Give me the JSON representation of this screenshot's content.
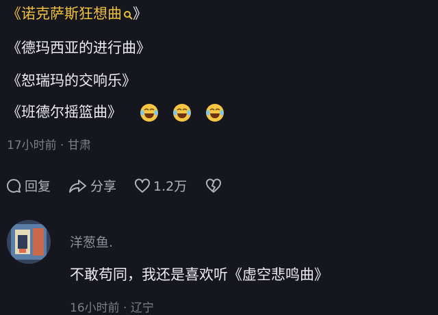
{
  "comment": {
    "lines": [
      "《诺克萨斯狂想曲",
      "》",
      "《德玛西亚的进行曲》",
      "《恕瑞玛的交响乐》",
      "《班德尔摇篮曲》"
    ],
    "emojis": [
      "laugh-cry-emoji",
      "laugh-cry-emoji",
      "laugh-cry-emoji"
    ],
    "meta": "17小时前 · 甘肃",
    "actions": {
      "reply_label": "回复",
      "share_label": "分享",
      "like_count": "1.2万"
    }
  },
  "reply": {
    "username": "洋葱鱼.",
    "text": "不敢苟同，我还是喜欢听《虚空悲鸣曲》",
    "meta": "16小时前 · 辽宁"
  },
  "colors": {
    "background": "#15161e",
    "highlight": "#f0c23b",
    "muted": "#7d7e86"
  }
}
